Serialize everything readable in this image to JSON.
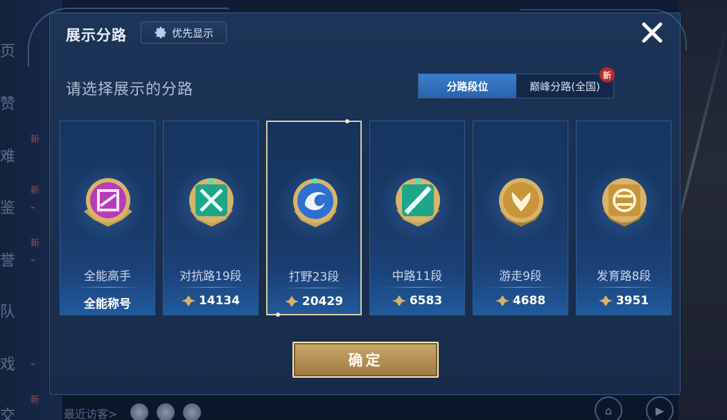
{
  "background": {
    "left_items": [
      "页",
      "赞",
      "难",
      "鉴",
      "誉",
      "队",
      "戏",
      "交"
    ],
    "new_tags": [
      "新",
      "新",
      "新",
      "新"
    ],
    "recent_visitors": "最近访客>"
  },
  "dialog": {
    "title": "展示分路",
    "priority_button": "优先显示",
    "subtitle": "请选择展示的分路",
    "tabs": [
      {
        "label": "分路段位",
        "active": true
      },
      {
        "label": "巅峰分路(全国)",
        "active": false,
        "badge": "新"
      }
    ],
    "cards": [
      {
        "rank_label": "全能高手",
        "score": "全能称号",
        "show_gem": false,
        "badge_color": "#b83bb8",
        "selected": false
      },
      {
        "rank_label": "对抗路19段",
        "score": "14134",
        "show_gem": true,
        "badge_color": "#1fa58a",
        "selected": false
      },
      {
        "rank_label": "打野23段",
        "score": "20429",
        "show_gem": true,
        "badge_color": "#2f6fd0",
        "selected": true
      },
      {
        "rank_label": "中路11段",
        "score": "6583",
        "show_gem": true,
        "badge_color": "#1fa58a",
        "selected": false
      },
      {
        "rank_label": "游走9段",
        "score": "4688",
        "show_gem": true,
        "badge_color": "#c9953a",
        "selected": false
      },
      {
        "rank_label": "发育路8段",
        "score": "3951",
        "show_gem": true,
        "badge_color": "#c9953a",
        "selected": false
      }
    ],
    "confirm_button": "确定"
  },
  "colors": {
    "gold": "#d6b36a",
    "accent_blue": "#2f6fd0",
    "new_badge": "#b52b2b"
  }
}
